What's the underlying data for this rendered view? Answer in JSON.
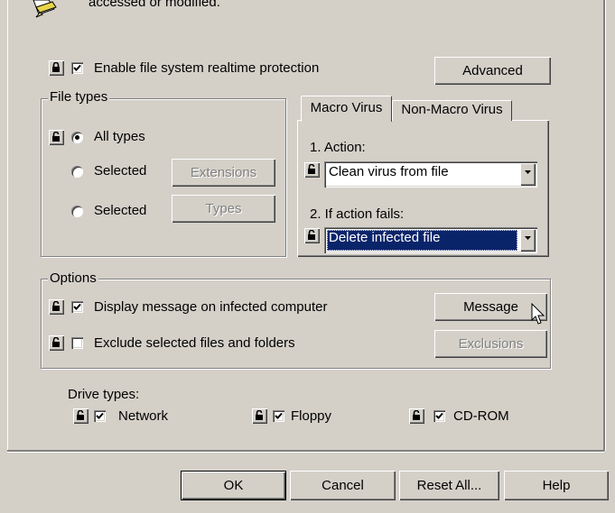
{
  "header": {
    "description_tail": "accessed or modified."
  },
  "main": {
    "enable_realtime": {
      "label": "Enable file system realtime protection",
      "checked": true,
      "locked": true
    },
    "advanced_label": "Advanced",
    "file_types": {
      "title": "File types",
      "all_types_label": "All types",
      "selected_label_1": "Selected",
      "selected_label_2": "Selected",
      "extensions_label": "Extensions",
      "types_label": "Types"
    },
    "macro": {
      "tabs": [
        "Macro Virus",
        "Non-Macro Virus"
      ],
      "action_label": "1. Action:",
      "action_value": "Clean virus from file",
      "fail_label": "2. If action fails:",
      "fail_value": "Delete infected file"
    },
    "options": {
      "title": "Options",
      "display_msg_label": "Display message on infected computer",
      "display_msg_checked": true,
      "exclude_label": "Exclude selected files and folders",
      "exclude_checked": false,
      "message_label": "Message",
      "exclusions_label": "Exclusions"
    },
    "drives": {
      "title": "Drive types:",
      "network_label": "Network",
      "floppy_label": "Floppy",
      "cdrom_label": "CD-ROM"
    }
  },
  "footer": {
    "ok_label": "OK",
    "cancel_label": "Cancel",
    "reset_label": "Reset All...",
    "help_label": "Help"
  }
}
